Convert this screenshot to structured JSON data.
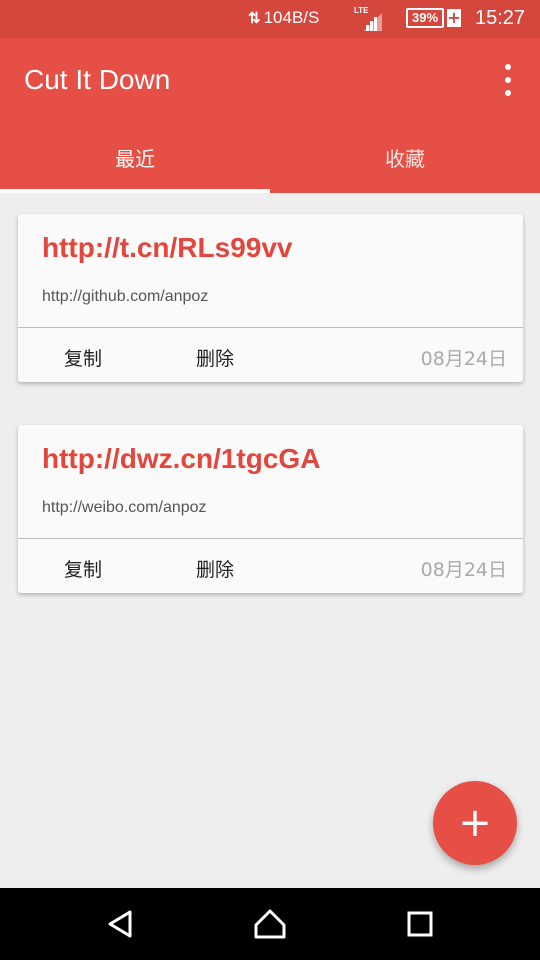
{
  "status_bar": {
    "network_speed": "104B/S",
    "network_icon": "data-transfer-arrows-icon",
    "signal_label": "LTE",
    "battery_percent": "39%",
    "battery_charging_symbol": "+",
    "time": "15:27"
  },
  "app_bar": {
    "title": "Cut It Down",
    "overflow_icon": "more-vert-icon"
  },
  "tabs": [
    {
      "label": "最近",
      "active": true
    },
    {
      "label": "收藏",
      "active": false
    }
  ],
  "cards": [
    {
      "short_url": "http://t.cn/RLs99vv",
      "long_url": "http://github.com/anpoz",
      "copy_label": "复制",
      "delete_label": "删除",
      "date": "08月24日"
    },
    {
      "short_url": "http://dwz.cn/1tgcGA",
      "long_url": "http://weibo.com/anpoz",
      "copy_label": "复制",
      "delete_label": "删除",
      "date": "08月24日"
    }
  ],
  "fab": {
    "symbol": "+",
    "icon": "add-icon"
  },
  "nav_bar": {
    "back_icon": "back-triangle-icon",
    "home_icon": "home-icon",
    "recents_icon": "recents-square-icon"
  },
  "colors": {
    "status_bar": "#d5473c",
    "primary": "#e64f45",
    "accent_text": "#e2463c",
    "background": "#eeeeee"
  }
}
